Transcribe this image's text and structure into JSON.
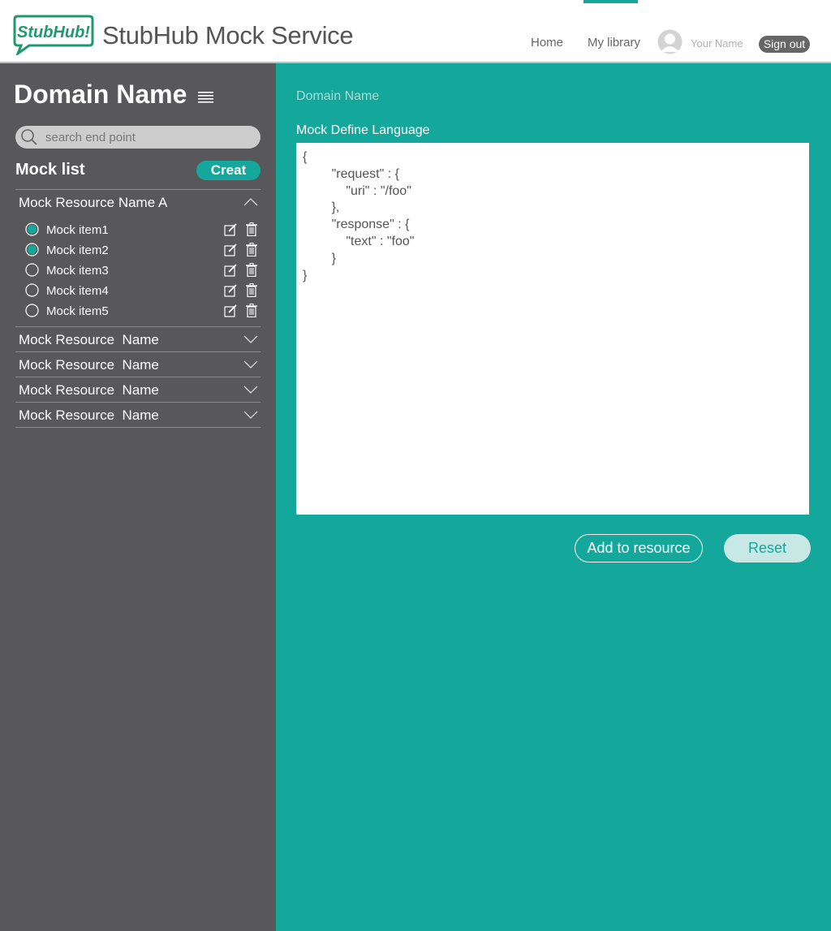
{
  "header": {
    "logo_text": "StubHub!",
    "app_title": "StubHub Mock Service",
    "nav": {
      "home": "Home",
      "library": "My library"
    },
    "user_name": "Your Name",
    "signout": "Sign out"
  },
  "sidebar": {
    "domain_title": "Domain Name",
    "search": {
      "placeholder": "search end point",
      "value": ""
    },
    "mock_list_title": "Mock list",
    "create_button": "Creat",
    "groups": [
      {
        "name": "Mock Resource Name A",
        "expanded": true,
        "items": [
          {
            "label": "Mock item1",
            "selected": true
          },
          {
            "label": "Mock item2",
            "selected": true
          },
          {
            "label": "Mock item3",
            "selected": false
          },
          {
            "label": "Mock item4",
            "selected": false
          },
          {
            "label": "Mock item5",
            "selected": false
          }
        ]
      },
      {
        "name": "Mock Resource  Name",
        "expanded": false
      },
      {
        "name": "Mock Resource  Name",
        "expanded": false
      },
      {
        "name": "Mock Resource  Name",
        "expanded": false
      },
      {
        "name": "Mock Resource  Name",
        "expanded": false
      }
    ]
  },
  "main": {
    "breadcrumb": "Domain Name",
    "editor_label": "Mock Define Language",
    "editor_content": "{\n        \"request\" : {\n            \"uri\" : \"/foo\"\n        },\n        \"response\" : {\n            \"text\" : \"foo\"\n        }\n}",
    "add_button": "Add to resource",
    "reset_button": "Reset"
  },
  "colors": {
    "accent": "#14a89d",
    "sidebar_bg": "#58585a",
    "logo_green": "#1f9a6e"
  },
  "icons": [
    "stubhub-logo",
    "hamburger-icon",
    "search-icon",
    "chevron-up-icon",
    "chevron-down-icon",
    "radio-icon",
    "edit-icon",
    "trash-icon",
    "avatar-icon"
  ]
}
